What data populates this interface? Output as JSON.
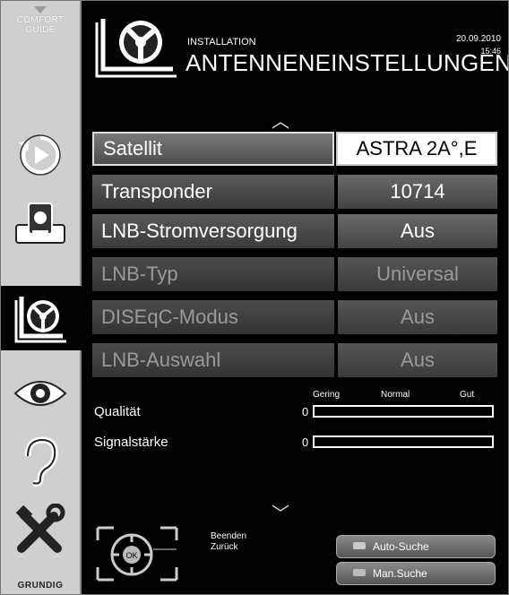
{
  "sidebar": {
    "comfort_line1": "COMFORT",
    "comfort_line2": "GUIDE",
    "brand": "GRUNDIG",
    "items": [
      {
        "icon": "source-icon"
      },
      {
        "icon": "media-icon"
      },
      {
        "icon": "installation-icon",
        "active": true
      },
      {
        "icon": "picture-eye-icon"
      },
      {
        "icon": "sound-ear-icon"
      },
      {
        "icon": "tools-icon"
      }
    ]
  },
  "header": {
    "subtitle": "INSTALLATION",
    "title": "ANTENNENEINSTELLUNGEN",
    "date": "20.09.2010",
    "time": "15:46"
  },
  "settings": [
    {
      "label": "Satellit",
      "value": "ASTRA 2A°,E",
      "state": "selected"
    },
    {
      "label": "Transponder",
      "value": "10714",
      "state": "normal"
    },
    {
      "label": "LNB-Stromversorgung",
      "value": "Aus",
      "state": "normal"
    },
    {
      "label": "LNB-Typ",
      "value": "Universal",
      "state": "disabled"
    },
    {
      "label": "DISEqC-Modus",
      "value": "Aus",
      "state": "disabled"
    },
    {
      "label": "LNB-Auswahl",
      "value": "Aus",
      "state": "disabled"
    }
  ],
  "signal": {
    "scale": [
      "Gering",
      "Normal",
      "Gut"
    ],
    "quality_label": "Qualität",
    "quality_value": "0",
    "strength_label": "Signalstärke",
    "strength_value": "0"
  },
  "footer": {
    "beenden": "Beenden",
    "zurueck": "Zurück",
    "auto_search": "Auto-Suche",
    "man_search": "Man.Suche"
  }
}
